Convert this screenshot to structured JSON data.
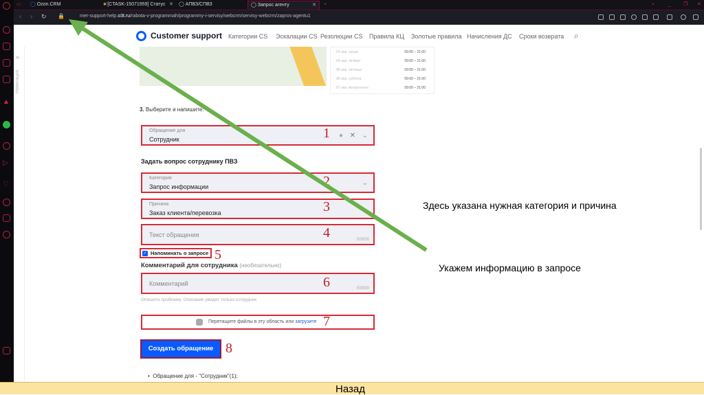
{
  "browser": {
    "tabs": [
      {
        "label": "Ozon.CRM"
      },
      {
        "label": "[CTASK-15071959] Статус"
      },
      {
        "label": "АПВЗ/СПВЗ"
      },
      {
        "label": "Запрос агенту",
        "active": true
      }
    ],
    "url_prefix": "mer-support-help.",
    "url_domain": "o3t.ru",
    "url_path": "/rabota-v-programmah/programmy-i-servisy/webcrm/servisy-webcrm/zapros-agentu1",
    "sidebar_icons": [
      "opera-icon",
      "messenger-icon",
      "bag-icon",
      "twitch-icon",
      "calendar-icon",
      "flame-icon",
      "whatsapp-icon",
      "player-icon",
      "send-icon",
      "heart-icon",
      "history-icon",
      "cube-icon",
      "settings-icon"
    ],
    "accent": "#b0203a"
  },
  "site": {
    "brand": "Customer support",
    "nav": [
      "Категории CS",
      "Эскалации CS",
      "Резолюции CS",
      "Правила КЦ",
      "Золотые правила",
      "Начисления ДС",
      "Сроки возврата"
    ],
    "side_nav": "Навигация",
    "schedule": [
      {
        "day": "03 апр. среда",
        "time": "09:00 – 21:00"
      },
      {
        "day": "04 апр. четверг",
        "time": "09:00 – 21:00"
      },
      {
        "day": "05 апр. пятница",
        "time": "09:00 – 21:00"
      },
      {
        "day": "06 апр. суббота",
        "time": "09:00 – 21:00"
      },
      {
        "day": "07 апр. воскресенье",
        "time": "09:00 – 21:00"
      }
    ],
    "step_num": "3.",
    "step_text": " Выберите и напишите:",
    "f1": {
      "label": "Обращение для",
      "value": "Сотрудник"
    },
    "section": "Задать вопрос сотруднику ПВЗ",
    "f2": {
      "label": "Категория",
      "value": "Запрос информации"
    },
    "f3": {
      "label": "Причина",
      "value": "Заказ клиента/перевозка"
    },
    "f4": {
      "placeholder": "Текст обращения",
      "count": "0/3000"
    },
    "remind": {
      "label": "Напоминать о запросе",
      "checked": true
    },
    "comment_title": "Комментарий для сотрудника",
    "comment_opt": "(необязательно)",
    "f6": {
      "placeholder": "Комментарий",
      "count": "0/3000"
    },
    "comment_hint": "Опишите проблему. Описание увидит только сотрудник",
    "upload_text": "Перетащите файлы в эту область или ",
    "upload_link": "загрузите",
    "submit": "Создать обращение",
    "bullet": "Обращение для - \"Сотрудник\"(1);"
  },
  "annotations": {
    "numbers": [
      "1",
      "2",
      "3",
      "4",
      "5",
      "6",
      "7",
      "8"
    ],
    "note1": "Здесь указана нужная категория и причина",
    "note2": "Укажем информацию в запросе",
    "arrow_color": "#6ab04c",
    "box_color": "#d62a36"
  },
  "footer": {
    "back": "Назад"
  }
}
